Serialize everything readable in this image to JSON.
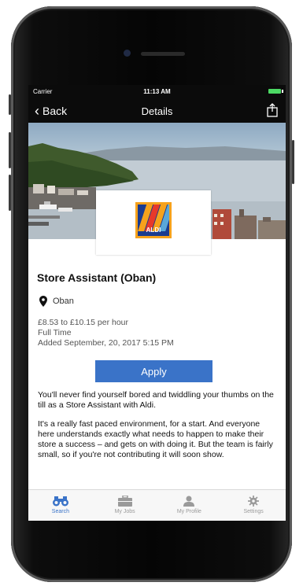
{
  "status_bar": {
    "carrier": "Carrier",
    "time": "11:13 AM"
  },
  "nav": {
    "back_label": "Back",
    "title": "Details"
  },
  "logo_text": "ALDI",
  "job": {
    "title": "Store Assistant (Oban)",
    "location": "Oban",
    "pay": "£8.53 to £10.15 per hour",
    "type": "Full Time",
    "added": "Added September, 20, 2017 5:15 PM"
  },
  "apply_label": "Apply",
  "description": [
    "You'll never find yourself bored and twiddling your thumbs on the till as a Store Assistant with Aldi.",
    "It's a really fast paced environment, for a start. And everyone here understands exactly what needs to happen to make their store a success – and gets on with doing it. But the team is fairly small, so if you're not contributing it will soon show."
  ],
  "tabs": [
    {
      "label": "Search",
      "icon": "binoculars-icon",
      "active": true
    },
    {
      "label": "My Jobs",
      "icon": "briefcase-icon",
      "active": false
    },
    {
      "label": "My Profile",
      "icon": "person-icon",
      "active": false
    },
    {
      "label": "Settings",
      "icon": "gear-icon",
      "active": false
    }
  ],
  "colors": {
    "accent": "#3a73c8",
    "nav_bg": "#0b0b0b",
    "battery": "#4cd964",
    "aldi_blue": "#1b3b8f",
    "aldi_orange": "#f6a21c"
  }
}
